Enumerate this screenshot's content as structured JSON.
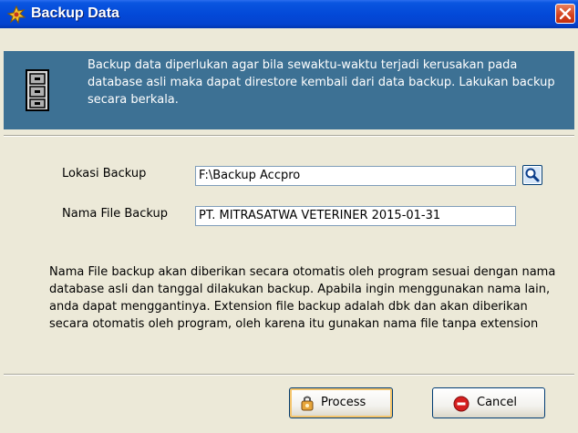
{
  "window": {
    "title": "Backup Data"
  },
  "banner": {
    "text": "Backup data diperlukan agar bila sewaktu-waktu terjadi kerusakan pada database asli maka dapat direstore kembali dari data backup. Lakukan backup secara berkala."
  },
  "form": {
    "lokasi_label": "Lokasi Backup",
    "lokasi_value": "F:\\Backup Accpro",
    "nama_label": "Nama File Backup",
    "nama_value": "PT. MITRASATWA VETERINER 2015-01-31"
  },
  "note": "Nama File backup akan diberikan secara otomatis oleh program sesuai dengan nama database asli dan tanggal dilakukan backup. Apabila ingin menggunakan nama lain, anda dapat menggantinya. Extension file backup adalah dbk dan akan diberikan secara otomatis oleh program, oleh karena itu gunakan nama file tanpa extension",
  "buttons": {
    "process": "Process",
    "cancel": "Cancel"
  },
  "icons": {
    "title": "backup-app-icon",
    "banner": "file-cabinet-icon",
    "browse": "search-icon",
    "process": "process-icon",
    "cancel": "cancel-icon",
    "close": "close-icon"
  },
  "colors": {
    "titlebar": "#0349d8",
    "banner": "#3d7194",
    "window": "#ece9d8",
    "close": "#d3401c"
  }
}
